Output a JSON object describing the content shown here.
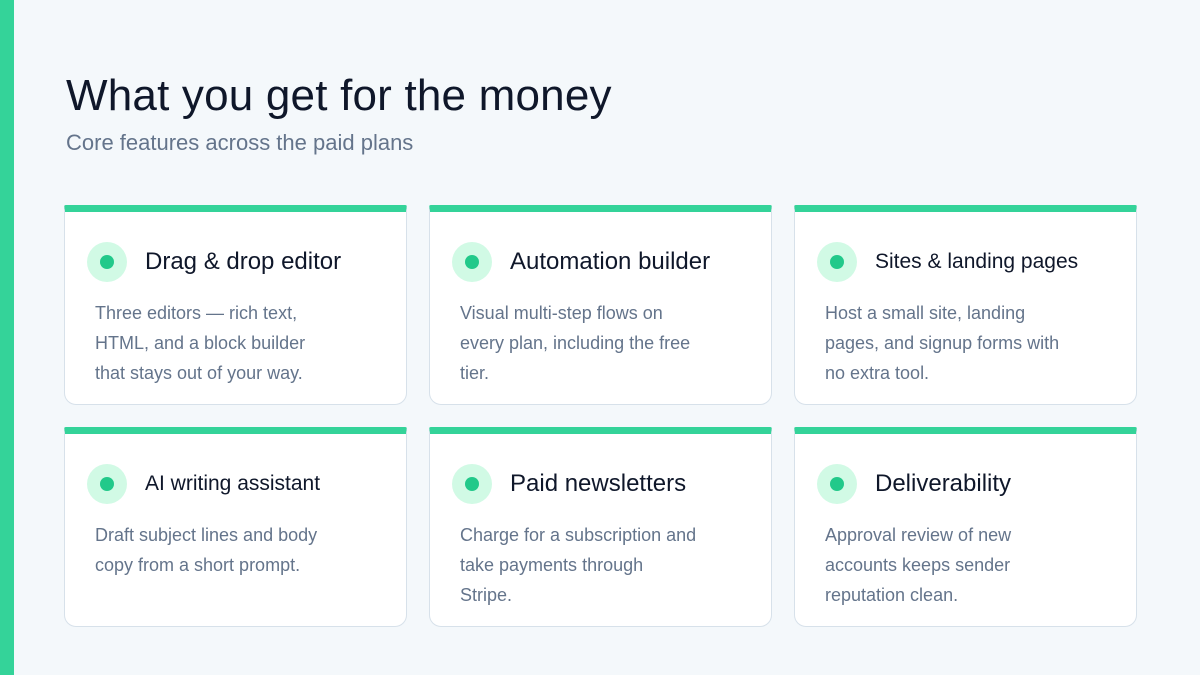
{
  "header": {
    "title": "What you get for the money",
    "subtitle": "Core features across the paid plans"
  },
  "colors": {
    "accent": "#34d399",
    "dot": "#22c98a",
    "dot_bg": "#d1fae5",
    "title": "#0f172a",
    "muted": "#64748b",
    "background": "#f4f8fb"
  },
  "features": [
    {
      "title": "Drag & drop editor",
      "description": "Three editors — rich text, HTML, and a block builder that stays out of your way.",
      "icon": "status-dot-icon"
    },
    {
      "title": "Automation builder",
      "description": "Visual multi-step flows on every plan, including the free tier.",
      "icon": "status-dot-icon"
    },
    {
      "title": "Sites & landing pages",
      "description": "Host a small site, landing pages, and signup forms with no extra tool.",
      "icon": "status-dot-icon"
    },
    {
      "title": "AI writing assistant",
      "description": "Draft subject lines and body copy from a short prompt.",
      "icon": "status-dot-icon"
    },
    {
      "title": "Paid newsletters",
      "description": "Charge for a subscription and take payments through Stripe.",
      "icon": "status-dot-icon"
    },
    {
      "title": "Deliverability",
      "description": "Approval review of new accounts keeps sender reputation clean.",
      "icon": "status-dot-icon"
    }
  ]
}
